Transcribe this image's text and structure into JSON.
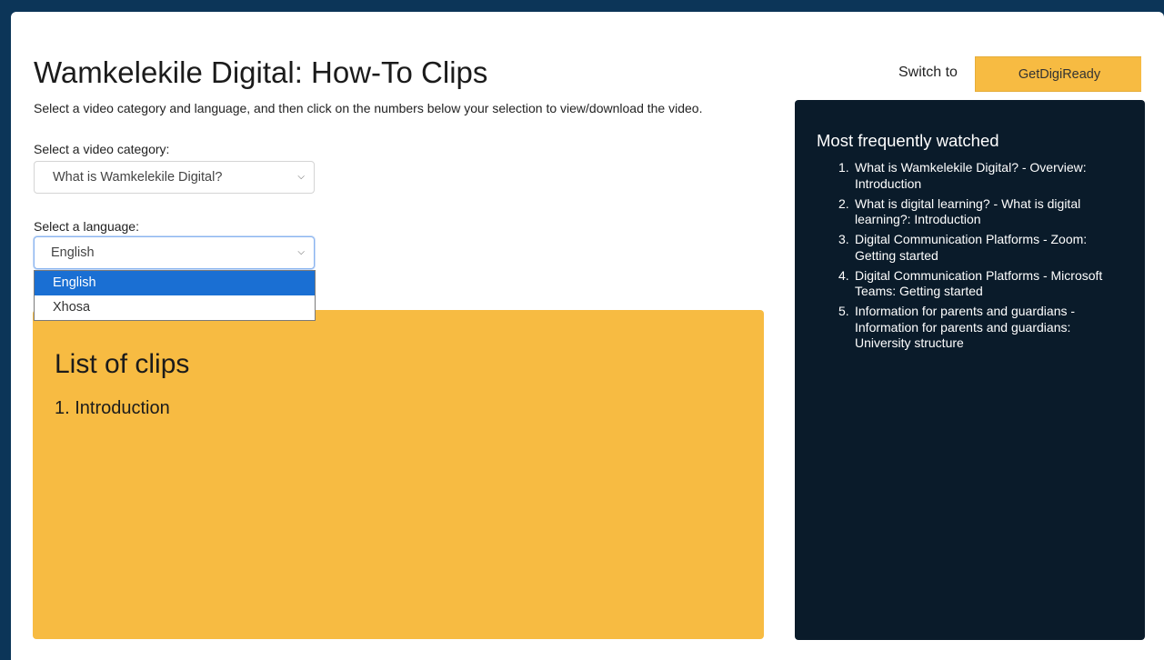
{
  "header": {
    "title": "Wamkelekile Digital: How-To Clips",
    "intro": "Select a video category and language, and then click on the numbers below your selection to view/download the video.",
    "switch_label": "Switch to",
    "switch_button": "GetDigiReady"
  },
  "category": {
    "label": "Select a video category:",
    "selected": "What is Wamkelekile Digital?"
  },
  "language": {
    "label": "Select a language:",
    "selected": "English",
    "options": [
      "English",
      "Xhosa"
    ]
  },
  "clips": {
    "title": "List of clips",
    "items": [
      "1. Introduction"
    ]
  },
  "most_watched": {
    "title": "Most frequently watched",
    "items": [
      {
        "num": "1.",
        "text": "What is Wamkelekile Digital? - Overview: Introduction"
      },
      {
        "num": "2.",
        "text": "What is digital learning? - What is digital learning?: Introduction"
      },
      {
        "num": "3.",
        "text": "Digital Communication Platforms - Zoom: Getting started"
      },
      {
        "num": "4.",
        "text": "Digital Communication Platforms - Microsoft Teams: Getting started"
      },
      {
        "num": "5.",
        "text": "Information for parents and guardians - Information for parents and guardians: University structure"
      }
    ]
  },
  "colors": {
    "page_border": "#0c3558",
    "accent": "#f7bb42",
    "sidebar_bg": "#0a1b2a",
    "selected_option": "#1a6fd3"
  },
  "icons": {
    "select_arrow": "chevron-down-icon"
  }
}
